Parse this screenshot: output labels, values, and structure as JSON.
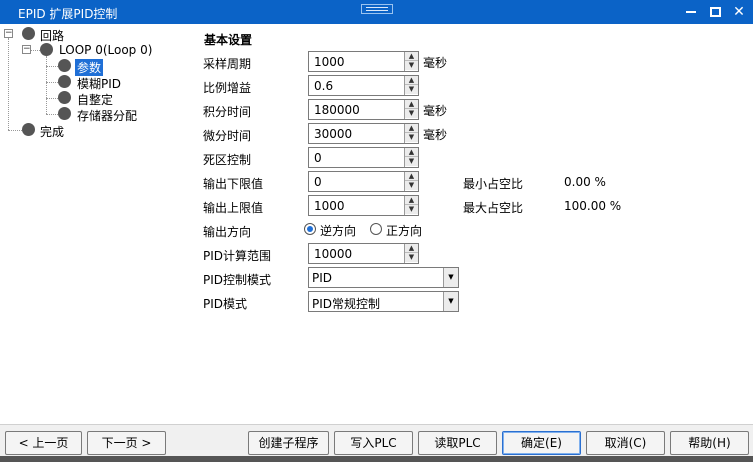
{
  "window": {
    "title": "EPID 扩展PID控制"
  },
  "tree": {
    "root": "回路",
    "loop": "LOOP 0(Loop 0)",
    "children": [
      "参数",
      "模糊PID",
      "自整定",
      "存储器分配"
    ],
    "selected": "参数",
    "done": "完成"
  },
  "form": {
    "section": "基本设置",
    "sample_period": {
      "label": "采样周期",
      "value": "1000",
      "unit": "毫秒"
    },
    "proportional_gain": {
      "label": "比例增益",
      "value": "0.6"
    },
    "integral_time": {
      "label": "积分时间",
      "value": "180000",
      "unit": "毫秒"
    },
    "derivative_time": {
      "label": "微分时间",
      "value": "30000",
      "unit": "毫秒"
    },
    "deadband": {
      "label": "死区控制",
      "value": "0"
    },
    "output_low": {
      "label": "输出下限值",
      "value": "0",
      "stat_label": "最小占空比",
      "stat_value": "0.00 %"
    },
    "output_high": {
      "label": "输出上限值",
      "value": "1000",
      "stat_label": "最大占空比",
      "stat_value": "100.00 %"
    },
    "output_direction": {
      "label": "输出方向",
      "options": [
        "逆方向",
        "正方向"
      ],
      "selected": "逆方向"
    },
    "pid_range": {
      "label": "PID计算范围",
      "value": "10000"
    },
    "pid_control_mode": {
      "label": "PID控制模式",
      "value": "PID"
    },
    "pid_mode": {
      "label": "PID模式",
      "value": "PID常规控制"
    }
  },
  "buttons": {
    "prev": "< 上一页",
    "next": "下一页 >",
    "create_sub": "创建子程序",
    "write_plc": "写入PLC",
    "read_plc": "读取PLC",
    "ok": "确定(E)",
    "cancel": "取消(C)",
    "help": "帮助(H)"
  },
  "icons": {
    "spin_up": "arrow-up-icon",
    "spin_down": "arrow-down-icon",
    "dropdown": "chevron-down-icon"
  },
  "colors": {
    "titlebar": "#0b63c7",
    "selection": "#1f6fd6"
  }
}
